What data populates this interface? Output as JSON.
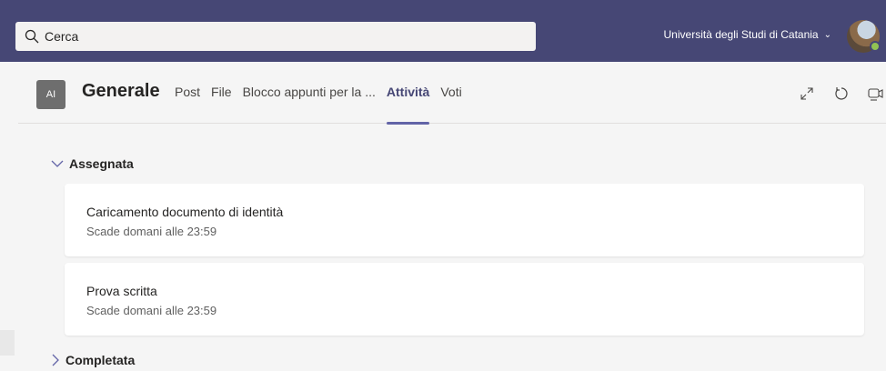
{
  "topbar": {
    "search_placeholder": "Cerca",
    "organization": "Università degli Studi di Catania",
    "org_chevron": "⌄",
    "presence_status": "available"
  },
  "channel": {
    "team_initials": "AI",
    "name": "Generale",
    "tabs": [
      {
        "label": "Post",
        "active": false
      },
      {
        "label": "File",
        "active": false
      },
      {
        "label": "Blocco appunti per la ...",
        "active": false
      },
      {
        "label": "Attività",
        "active": true
      },
      {
        "label": "Voti",
        "active": false
      }
    ],
    "header_icons": [
      "expand-icon",
      "refresh-icon",
      "meet-icon"
    ]
  },
  "sections": {
    "assigned": {
      "label": "Assegnata",
      "expanded": true,
      "items": [
        {
          "title": "Caricamento documento di identità",
          "due": "Scade domani alle 23:59"
        },
        {
          "title": "Prova scritta",
          "due": "Scade domani alle 23:59"
        }
      ]
    },
    "completed": {
      "label": "Completata",
      "expanded": false
    }
  },
  "colors": {
    "topbar": "#464775",
    "accent": "#6264a7",
    "background": "#f5f5f5"
  }
}
